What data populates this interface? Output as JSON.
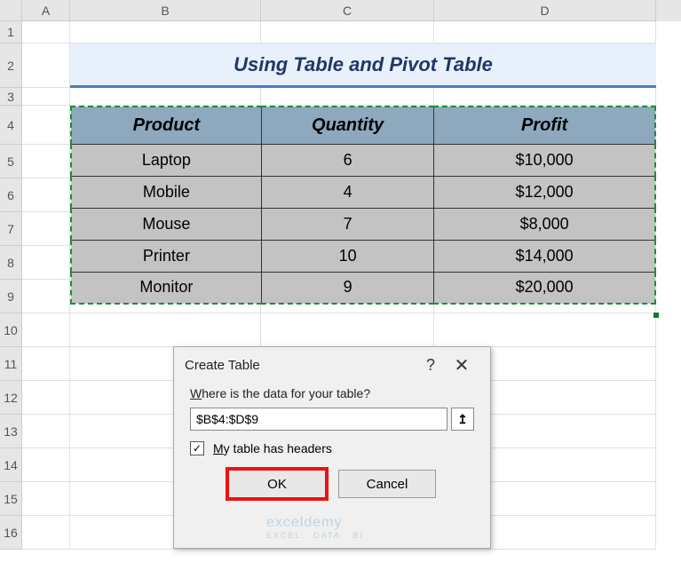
{
  "columns": [
    "A",
    "B",
    "C",
    "D"
  ],
  "rows": [
    "1",
    "2",
    "3",
    "4",
    "5",
    "6",
    "7",
    "8",
    "9",
    "10",
    "11",
    "12",
    "13",
    "14",
    "15",
    "16"
  ],
  "title": "Using Table and Pivot Table",
  "table": {
    "headers": [
      "Product",
      "Quantity",
      "Profit"
    ],
    "data": [
      [
        "Laptop",
        "6",
        "$10,000"
      ],
      [
        "Mobile",
        "4",
        "$12,000"
      ],
      [
        "Mouse",
        "7",
        "$8,000"
      ],
      [
        "Printer",
        "10",
        "$14,000"
      ],
      [
        "Monitor",
        "9",
        "$20,000"
      ]
    ]
  },
  "dialog": {
    "title": "Create Table",
    "help": "?",
    "close": "✕",
    "prompt_prefix": "W",
    "prompt_rest": "here is the data for your table?",
    "range": "$B$4:$D$9",
    "range_btn": "↥",
    "checkbox_checked": "✓",
    "checkbox_prefix": "M",
    "checkbox_rest": "y table has headers",
    "ok": "OK",
    "cancel": "Cancel"
  },
  "watermark": {
    "main": "exceldemy",
    "sub": "EXCEL · DATA · BI"
  }
}
